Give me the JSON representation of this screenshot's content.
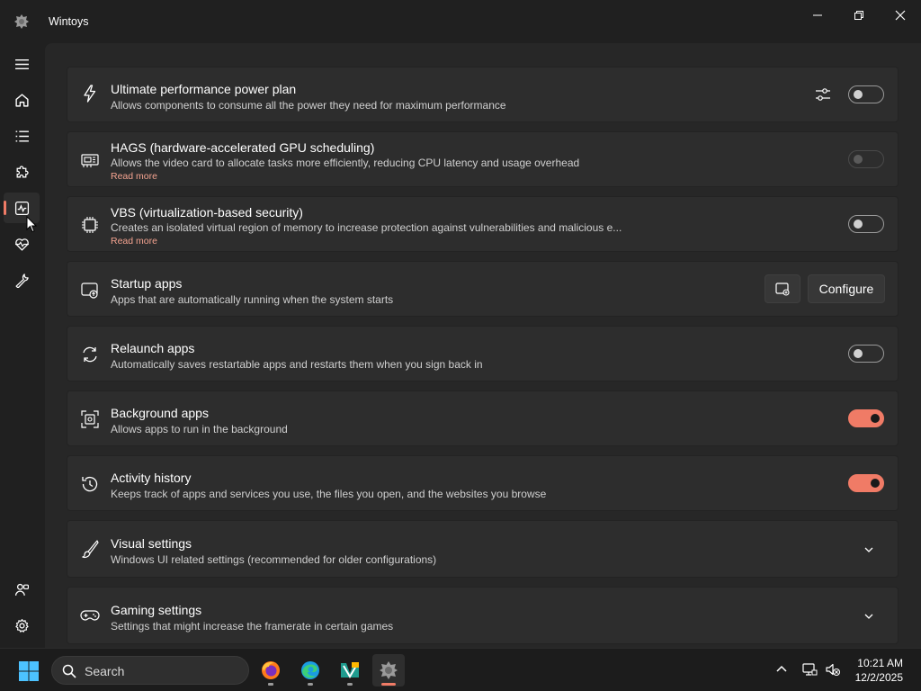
{
  "app": {
    "title": "Wintoys"
  },
  "nav": {
    "items": [
      {
        "name": "menu",
        "icon": "hamburger-icon"
      },
      {
        "name": "home",
        "icon": "home-icon"
      },
      {
        "name": "apps",
        "icon": "list-icon"
      },
      {
        "name": "extensions",
        "icon": "puzzle-icon"
      },
      {
        "name": "performance",
        "icon": "activity-monitor-icon",
        "active": true
      },
      {
        "name": "health",
        "icon": "heartbeat-icon"
      },
      {
        "name": "repair",
        "icon": "wrench-icon"
      },
      {
        "name": "account",
        "icon": "people-icon"
      },
      {
        "name": "settings",
        "icon": "gear-icon"
      }
    ]
  },
  "cards": [
    {
      "title": "Ultimate performance power plan",
      "description": "Allows components to consume all the power they need for maximum performance",
      "icon": "lightning-icon",
      "control": "toggle",
      "state": "off",
      "extra": "sliders-icon"
    },
    {
      "title": "HAGS (hardware-accelerated GPU scheduling)",
      "description": "Allows the video card to allocate tasks more efficiently, reducing CPU latency and usage overhead",
      "link": "Read more",
      "icon": "gpu-icon",
      "control": "toggle",
      "state": "disabled"
    },
    {
      "title": "VBS (virtualization-based security)",
      "description": "Creates an isolated virtual region of memory to increase protection against vulnerabilities and malicious e...",
      "link": "Read more",
      "icon": "chip-icon",
      "control": "toggle",
      "state": "off"
    },
    {
      "title": "Startup apps",
      "description": "Apps that are automatically running when the system starts",
      "icon": "startup-icon",
      "control": "button",
      "button_label": "Configure",
      "extra": "open-window-icon"
    },
    {
      "title": "Relaunch apps",
      "description": "Automatically saves restartable apps and restarts them when you sign back in",
      "icon": "relaunch-icon",
      "control": "toggle",
      "state": "off"
    },
    {
      "title": "Background apps",
      "description": "Allows apps to run in the background",
      "icon": "background-apps-icon",
      "control": "toggle",
      "state": "on"
    },
    {
      "title": "Activity history",
      "description": "Keeps track of apps and services you use, the files you open, and the websites you browse",
      "icon": "history-icon",
      "control": "toggle",
      "state": "on"
    },
    {
      "title": "Visual settings",
      "description": "Windows UI related settings (recommended for older configurations)",
      "icon": "brush-icon",
      "control": "expander"
    },
    {
      "title": "Gaming settings",
      "description": "Settings that might increase the framerate in certain games",
      "icon": "gamepad-icon",
      "control": "expander"
    }
  ],
  "taskbar": {
    "search_placeholder": "Search",
    "apps": [
      "firefox-icon",
      "edge-icon",
      "visual-studio-icon",
      "wintoys-icon"
    ],
    "time": "10:21 AM",
    "date": "12/2/2025"
  },
  "colors": {
    "accent": "#f07b66",
    "background": "#202020",
    "card": "#2d2d2d"
  }
}
